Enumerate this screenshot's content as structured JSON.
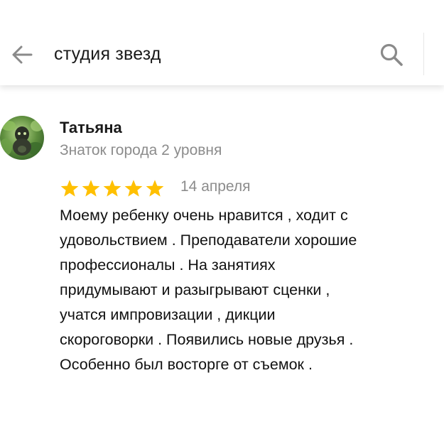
{
  "search": {
    "query": "студия звезд",
    "back_icon": "arrow-left-icon",
    "search_icon": "magnifier-icon"
  },
  "review": {
    "author": {
      "name": "Татьяна",
      "level": "Знаток города 2 уровня",
      "avatar": "avatar-photo"
    },
    "rating": {
      "stars": 5,
      "max": 5,
      "color": "#ffc000"
    },
    "date": "14 апреля",
    "text_lines": [
      "Моему ребенку очень нравится , ходит с",
      "удовольствием . Преподаватели хорошие",
      "профессионалы . На занятиях",
      "придумывают и разыгрывают сценки ,",
      "учатся импровизации , дикции",
      "скороговорки . Появились новые друзья .",
      "Особенно был восторге от съемок ."
    ]
  },
  "colors": {
    "text": "#1a1a1a",
    "muted": "#8c8c8c",
    "icon": "#8a8a8a",
    "star": "#ffc000"
  }
}
